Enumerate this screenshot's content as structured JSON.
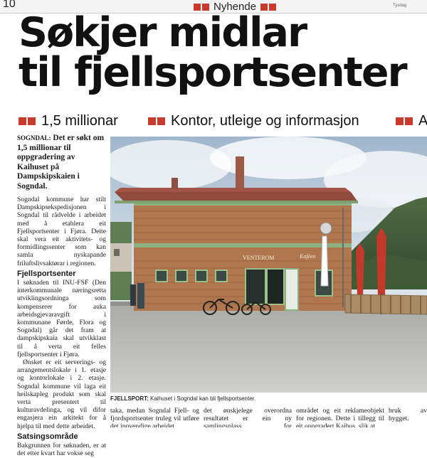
{
  "topbar": {
    "page_number": "10",
    "section": "Nyhende",
    "paper_name": "Tysdag"
  },
  "headline": {
    "line1": "Søkjer midlar",
    "line2": "til fjellsportsenter"
  },
  "subheads": [
    "1,5 millionar",
    "Kontor, utleige og informasjon",
    "A"
  ],
  "left_column": {
    "lead_dateline": "SOGNDAL:",
    "lead_text": "Det er søkt om 1,5 millionar til oppgradering av Kaihuset på Dampskipskaien i Sogndal.",
    "para1": "Sogndal kommune har stilt Dampskipsekspedisjonen i Sogndal til rådvelde i arbeidet med å etablera eit Fjellsportsenter i Fjøra. Dette skal vera eit aktivitets- og formidlingssenter som kan samla nyskapande friluftslivsaktørar i regionen.",
    "subhead1": "Fjellsportsenter",
    "para2": "I søknaden til INU-FSF (Den interkommunale næringsretta utviklingsordninga som kompenserer for auka arbeidsgjevaravgift i kommunane Førde, Flora og Sogndal) går det fram at dampskipskaia skal utvikklast til å verta eit felles fjellsportsenter i Fjøra.",
    "para3": "Ønsket er eit serverings- og arrangementslokale i 1. etasje og kontorlokale i 2. etasje. Sogndal kommune vil laga eit heilskapleg produkt som skal verta presentert til kulturavdelinga, og vil difor engasjera ein arkitekt for å hjelpa til med dette arbeidet.",
    "subhead2": "Satsingsområde",
    "para4": "Bakgrunnen for søknaden, er at det etter kvart har vokse seg"
  },
  "photo": {
    "sign_left": "VENTEROM",
    "sign_right": "Kaféen"
  },
  "caption": {
    "label": "FJELLSPORT:",
    "text": "Kaihuset i Sogndal kan bli fjellsportsenter."
  },
  "bottom_columns": [
    "taka, medan Sogndal Fjell- og fjordsportsenter truleg vil utføre det innvendige arbeidet.",
    "det ønskjelege overordna resultatet er ein ny samlingsplass for friluftsaktivitetar ein sam-",
    "området og eit reklameobjekt for regionen. Dette i tillegg til eit oppgradert Kaihus, slik at",
    "bruk av bygget."
  ]
}
